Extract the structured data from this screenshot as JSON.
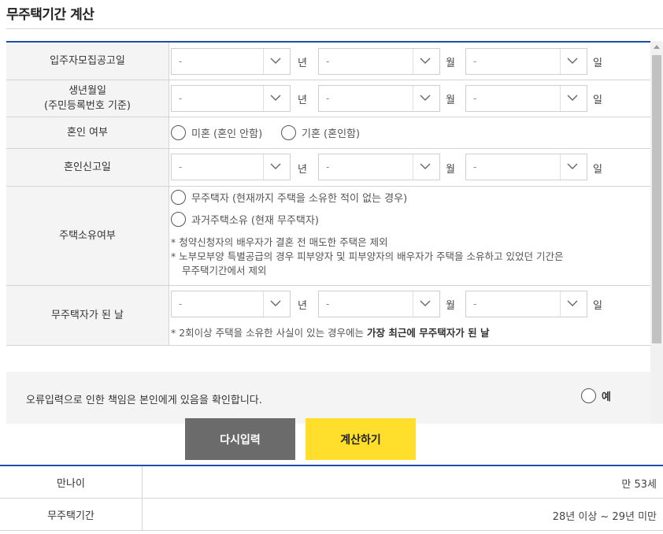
{
  "page": {
    "title": "무주택기간 계산"
  },
  "form": {
    "recruit_date": {
      "label": "입주자모집공고일",
      "year": "-",
      "month": "-",
      "day": "-",
      "unit_year": "년",
      "unit_month": "월",
      "unit_day": "일"
    },
    "birth_date": {
      "label_line1": "생년월일",
      "label_line2": "(주민등록번호 기준)",
      "year": "-",
      "month": "-",
      "day": "-",
      "unit_year": "년",
      "unit_month": "월",
      "unit_day": "일"
    },
    "marriage": {
      "label": "혼인 여부",
      "option_single": "미혼 (혼인 안함)",
      "option_married": "기혼 (혼인함)"
    },
    "marriage_date": {
      "label": "혼인신고일",
      "year": "-",
      "month": "-",
      "day": "-",
      "unit_year": "년",
      "unit_month": "월",
      "unit_day": "일"
    },
    "ownership": {
      "label": "주택소유여부",
      "option_never": "무주택자 (현재까지 주택을 소유한 적이 없는 경우)",
      "option_past": "과거주택소유 (현재 무주택자)",
      "note1": "* 청약신청자의 배우자가 결혼 전 매도한 주택은 제외",
      "note2_line1": "* 노부모부양 특별공급의 경우 피부양자 및 피부양자의 배우자가 주택을 소유하고 있었던 기간은",
      "note2_line2": "무주택기간에서 제외"
    },
    "homeless_date": {
      "label": "무주택자가 된 날",
      "year": "-",
      "month": "-",
      "day": "-",
      "unit_year": "년",
      "unit_month": "월",
      "unit_day": "일",
      "note_prefix": "* 2회이상 주택을 소유한 사실이 있는 경우에는 ",
      "note_bold": "가장 최근에 무주택자가 된 날"
    }
  },
  "confirm": {
    "text": "오류입력으로 인한 책임은 본인에게 있음을 확인합니다.",
    "option_yes": "예"
  },
  "buttons": {
    "reset": "다시입력",
    "calculate": "계산하기"
  },
  "result": {
    "age_label": "만나이",
    "age_value": "만 53세",
    "period_label": "무주택기간",
    "period_value": "28년 이상 ~ 29년 미만"
  },
  "colors": {
    "accent": "#1a4fa3",
    "calc_button": "#ffdf2b",
    "reset_button": "#6b6b6b"
  }
}
